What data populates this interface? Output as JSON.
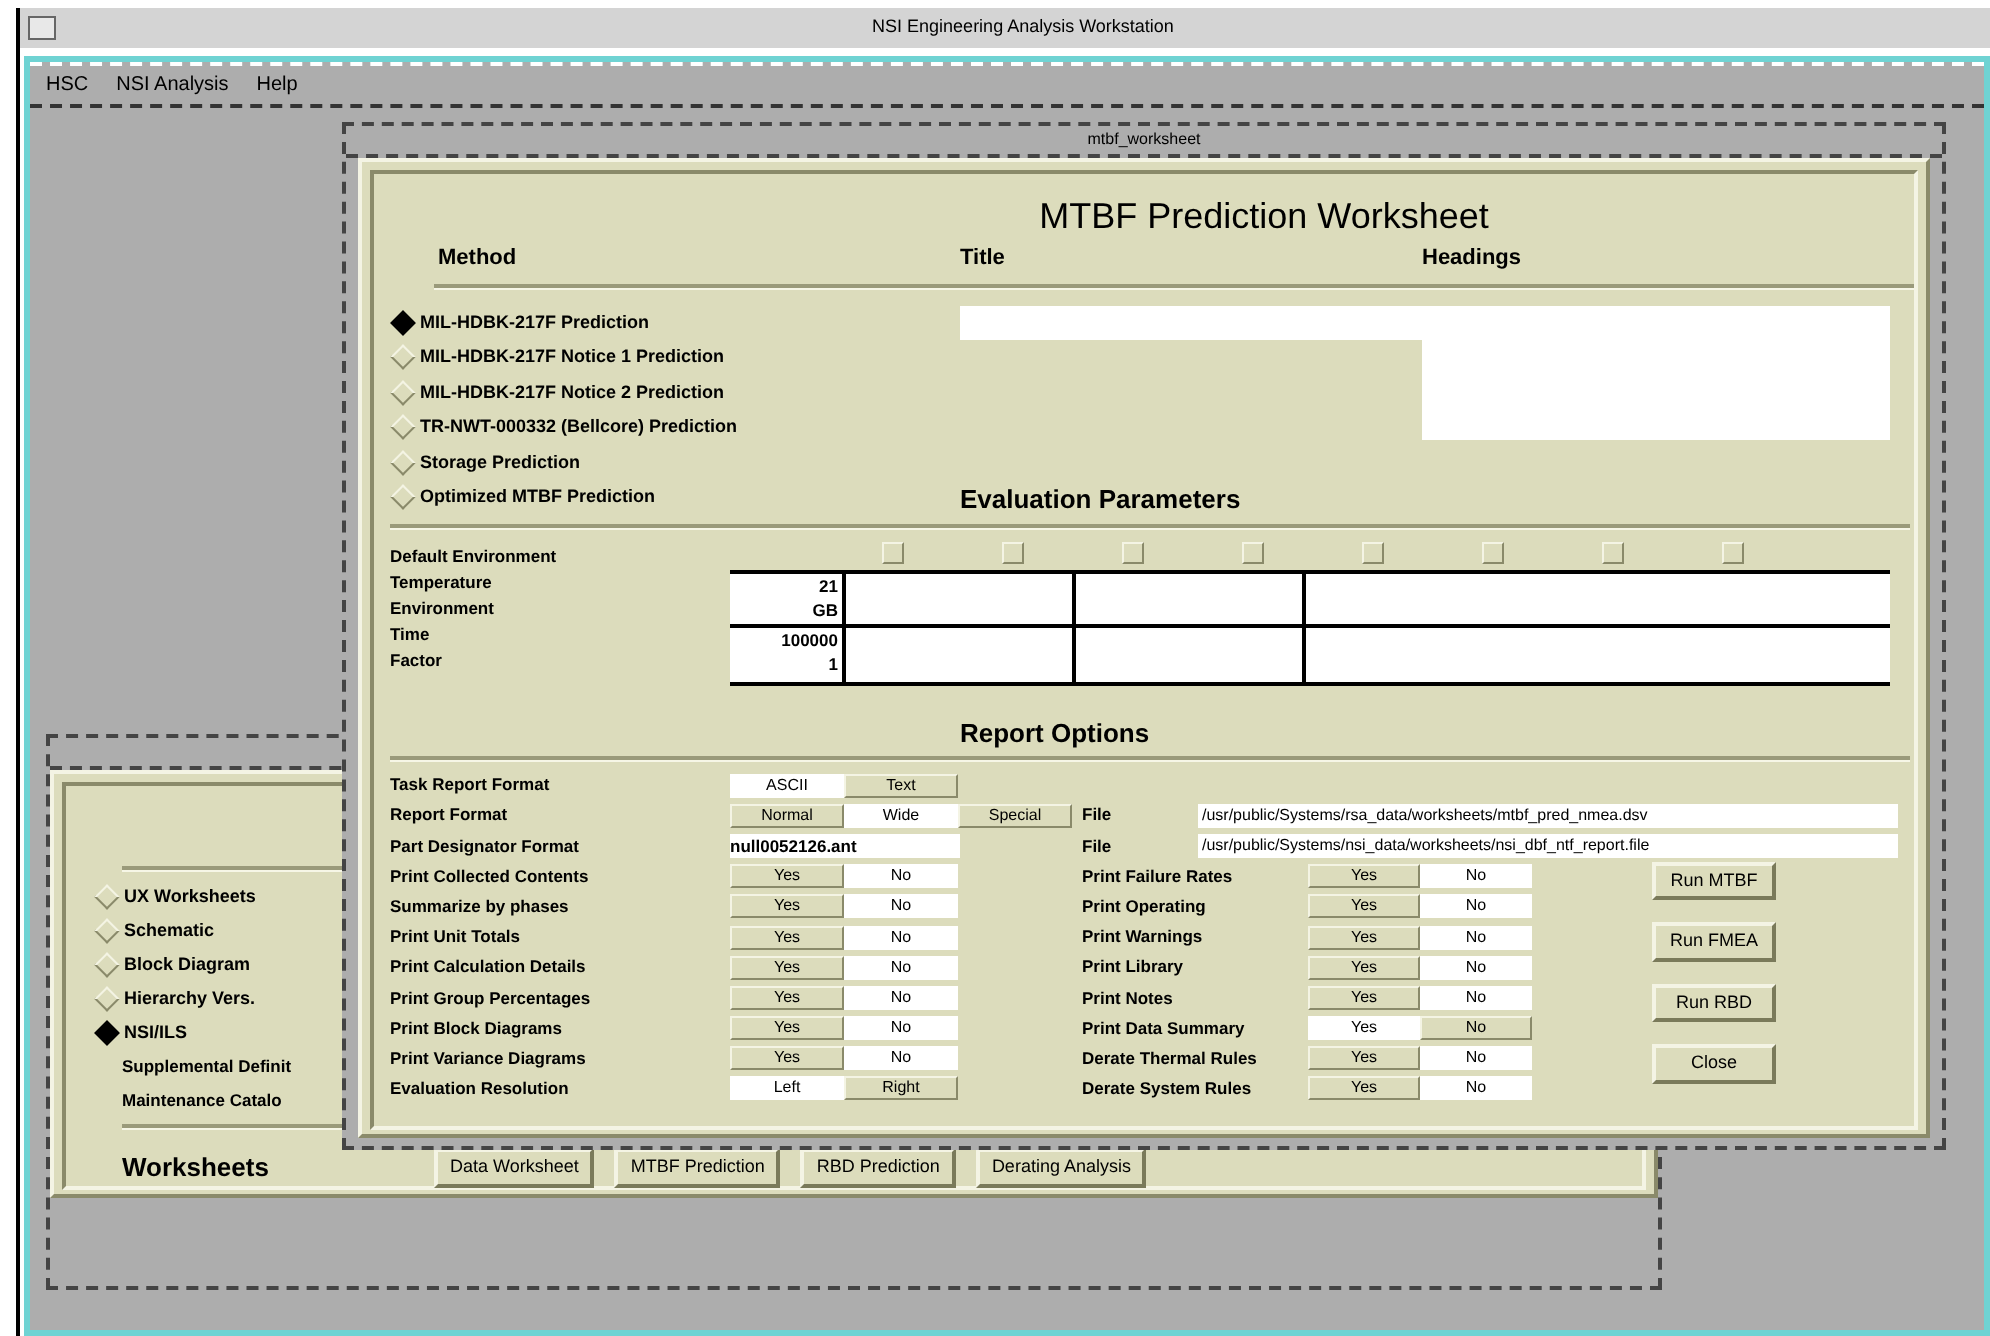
{
  "main_window": {
    "title": "NSI Engineering Analysis Workstation"
  },
  "menu": [
    {
      "label": "HSC"
    },
    {
      "label": "NSI Analysis"
    },
    {
      "label": "Help"
    }
  ],
  "background_window": {
    "options": [
      {
        "label": "UX Worksheets",
        "selected": false
      },
      {
        "label": "Schematic",
        "selected": false
      },
      {
        "label": "Block Diagram",
        "selected": false
      },
      {
        "label": "Hierarchy Vers.",
        "selected": false
      },
      {
        "label": "NSI/ILS",
        "selected": true
      }
    ],
    "notes": [
      "Supplemental Definit",
      "Maintenance Catalo"
    ],
    "section_label": "Worksheets",
    "buttons": [
      "Data Worksheet",
      "MTBF Prediction",
      "RBD Prediction",
      "Derating Analysis"
    ]
  },
  "worksheet_window": {
    "title": "mtbf_worksheet",
    "heading": "MTBF Prediction Worksheet",
    "column_labels": [
      "Method",
      "Title",
      "Headings"
    ],
    "methods": [
      {
        "label": "MIL-HDBK-217F Prediction",
        "selected": true
      },
      {
        "label": "MIL-HDBK-217F Notice 1 Prediction",
        "selected": false
      },
      {
        "label": "MIL-HDBK-217F Notice 2 Prediction",
        "selected": false
      },
      {
        "label": "TR-NWT-000332 (Bellcore) Prediction",
        "selected": false
      },
      {
        "label": "Storage Prediction",
        "selected": false
      },
      {
        "label": "Optimized MTBF Prediction",
        "selected": false
      }
    ],
    "evaluation": {
      "title": "Evaluation Parameters",
      "default_label": "Default Environment",
      "checkboxes": [
        {
          "checked": false
        },
        {
          "checked": false
        },
        {
          "checked": false
        },
        {
          "checked": false
        },
        {
          "checked": false
        },
        {
          "checked": false
        },
        {
          "checked": false
        },
        {
          "checked": false
        }
      ],
      "parameters": [
        {
          "label": "Temperature",
          "value": "21"
        },
        {
          "label": "Environment",
          "value": "GB"
        },
        {
          "label": "Time",
          "value": "100000"
        },
        {
          "label": "Factor",
          "value": "1"
        }
      ]
    },
    "report": {
      "title": "Report Options",
      "left_rows": [
        {
          "kind": "toggle",
          "label": "Task Report Format",
          "options": [
            {
              "label": "ASCII",
              "selected": true
            },
            {
              "label": "Text",
              "selected": false
            }
          ]
        },
        {
          "kind": "toggle",
          "label": "Report Format",
          "options": [
            {
              "label": "Normal",
              "selected": false
            },
            {
              "label": "Wide",
              "selected": true
            },
            {
              "label": "Special",
              "selected": false
            }
          ]
        },
        {
          "kind": "field",
          "label": "Part Designator Format",
          "value": "null0052126.ant"
        },
        {
          "kind": "toggle",
          "label": "Print Collected Contents",
          "options": [
            {
              "label": "Yes",
              "selected": false
            },
            {
              "label": "No",
              "selected": true
            }
          ]
        },
        {
          "kind": "toggle",
          "label": "Summarize by phases",
          "options": [
            {
              "label": "Yes",
              "selected": false
            },
            {
              "label": "No",
              "selected": true
            }
          ]
        },
        {
          "kind": "toggle",
          "label": "Print Unit Totals",
          "options": [
            {
              "label": "Yes",
              "selected": false
            },
            {
              "label": "No",
              "selected": true
            }
          ]
        },
        {
          "kind": "toggle",
          "label": "Print Calculation Details",
          "options": [
            {
              "label": "Yes",
              "selected": false
            },
            {
              "label": "No",
              "selected": true
            }
          ]
        },
        {
          "kind": "toggle",
          "label": "Print Group Percentages",
          "options": [
            {
              "label": "Yes",
              "selected": false
            },
            {
              "label": "No",
              "selected": true
            }
          ]
        },
        {
          "kind": "toggle",
          "label": "Print Block Diagrams",
          "options": [
            {
              "label": "Yes",
              "selected": false
            },
            {
              "label": "No",
              "selected": true
            }
          ]
        },
        {
          "kind": "toggle",
          "label": "Print Variance Diagrams",
          "options": [
            {
              "label": "Yes",
              "selected": false
            },
            {
              "label": "No",
              "selected": true
            }
          ]
        },
        {
          "kind": "toggle",
          "label": "Evaluation Resolution",
          "options": [
            {
              "label": "Left",
              "selected": true
            },
            {
              "label": "Right",
              "selected": false
            }
          ]
        }
      ],
      "files": [
        {
          "label": "File",
          "value": "/usr/public/Systems/rsa_data/worksheets/mtbf_pred_nmea.dsv"
        },
        {
          "label": "File",
          "value": "/usr/public/Systems/nsi_data/worksheets/nsi_dbf_ntf_report.file"
        }
      ],
      "right_rows": [
        {
          "label": "Print Failure Rates",
          "options": [
            {
              "label": "Yes",
              "selected": false
            },
            {
              "label": "No",
              "selected": true
            }
          ]
        },
        {
          "label": "Print Operating",
          "options": [
            {
              "label": "Yes",
              "selected": false
            },
            {
              "label": "No",
              "selected": true
            }
          ]
        },
        {
          "label": "Print Warnings",
          "options": [
            {
              "label": "Yes",
              "selected": false
            },
            {
              "label": "No",
              "selected": true
            }
          ]
        },
        {
          "label": "Print Library",
          "options": [
            {
              "label": "Yes",
              "selected": false
            },
            {
              "label": "No",
              "selected": true
            }
          ]
        },
        {
          "label": "Print Notes",
          "options": [
            {
              "label": "Yes",
              "selected": false
            },
            {
              "label": "No",
              "selected": true
            }
          ]
        },
        {
          "label": "Print Data Summary",
          "options": [
            {
              "label": "Yes",
              "selected": true
            },
            {
              "label": "No",
              "selected": false
            }
          ]
        },
        {
          "label": "Derate Thermal Rules",
          "options": [
            {
              "label": "Yes",
              "selected": false
            },
            {
              "label": "No",
              "selected": true
            }
          ]
        },
        {
          "label": "Derate System Rules",
          "options": [
            {
              "label": "Yes",
              "selected": false
            },
            {
              "label": "No",
              "selected": true
            }
          ]
        }
      ],
      "buttons": [
        "Run MTBF",
        "Run FMEA",
        "Run RBD",
        "Close"
      ]
    }
  }
}
